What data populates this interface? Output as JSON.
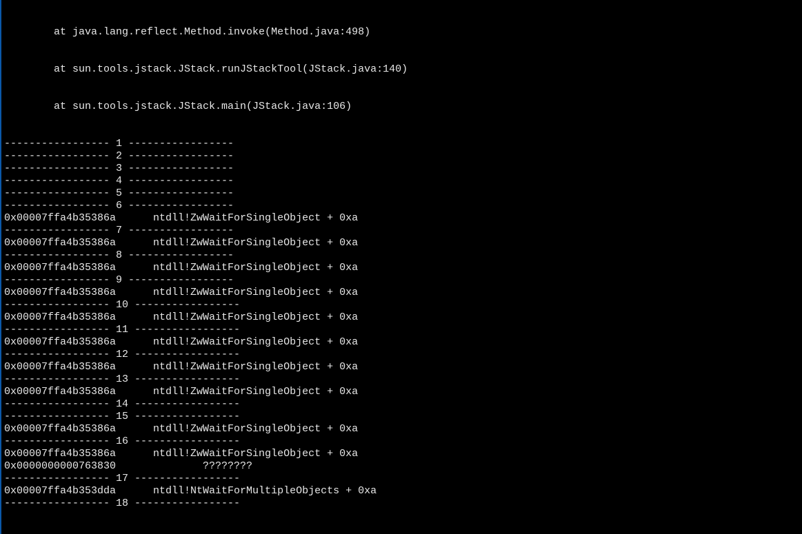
{
  "stack_top": [
    "        at java.lang.reflect.Method.invoke(Method.java:498)",
    "        at sun.tools.jstack.JStack.runJStackTool(JStack.java:140)",
    "        at sun.tools.jstack.JStack.main(JStack.java:106)"
  ],
  "separator_prefix": "----------------- ",
  "separator_suffix": " -----------------",
  "entries": [
    {
      "n": 1
    },
    {
      "n": 2
    },
    {
      "n": 3
    },
    {
      "n": 4
    },
    {
      "n": 5
    },
    {
      "n": 6
    },
    {
      "n": 6,
      "sep": false,
      "addr": "0x00007ffa4b35386a",
      "sym": "ntdll!ZwWaitForSingleObject + 0xa"
    },
    {
      "n": 7
    },
    {
      "n": 7,
      "sep": false,
      "addr": "0x00007ffa4b35386a",
      "sym": "ntdll!ZwWaitForSingleObject + 0xa"
    },
    {
      "n": 8
    },
    {
      "n": 8,
      "sep": false,
      "addr": "0x00007ffa4b35386a",
      "sym": "ntdll!ZwWaitForSingleObject + 0xa"
    },
    {
      "n": 9
    },
    {
      "n": 9,
      "sep": false,
      "addr": "0x00007ffa4b35386a",
      "sym": "ntdll!ZwWaitForSingleObject + 0xa"
    },
    {
      "n": 10
    },
    {
      "n": 10,
      "sep": false,
      "addr": "0x00007ffa4b35386a",
      "sym": "ntdll!ZwWaitForSingleObject + 0xa"
    },
    {
      "n": 11
    },
    {
      "n": 11,
      "sep": false,
      "addr": "0x00007ffa4b35386a",
      "sym": "ntdll!ZwWaitForSingleObject + 0xa"
    },
    {
      "n": 12
    },
    {
      "n": 12,
      "sep": false,
      "addr": "0x00007ffa4b35386a",
      "sym": "ntdll!ZwWaitForSingleObject + 0xa"
    },
    {
      "n": 13
    },
    {
      "n": 13,
      "sep": false,
      "addr": "0x00007ffa4b35386a",
      "sym": "ntdll!ZwWaitForSingleObject + 0xa"
    },
    {
      "n": 14
    },
    {
      "n": 15
    },
    {
      "n": 15,
      "sep": false,
      "addr": "0x00007ffa4b35386a",
      "sym": "ntdll!ZwWaitForSingleObject + 0xa"
    },
    {
      "n": 16
    },
    {
      "n": 16,
      "sep": false,
      "addr": "0x00007ffa4b35386a",
      "sym": "ntdll!ZwWaitForSingleObject + 0xa"
    },
    {
      "n": 16,
      "sep": false,
      "addr": "0x0000000000763830",
      "sym": "????????",
      "unknown": true
    },
    {
      "n": 17
    },
    {
      "n": 17,
      "sep": false,
      "addr": "0x00007ffa4b353dda",
      "sym": "ntdll!NtWaitForMultipleObjects + 0xa"
    },
    {
      "n": 18
    }
  ]
}
